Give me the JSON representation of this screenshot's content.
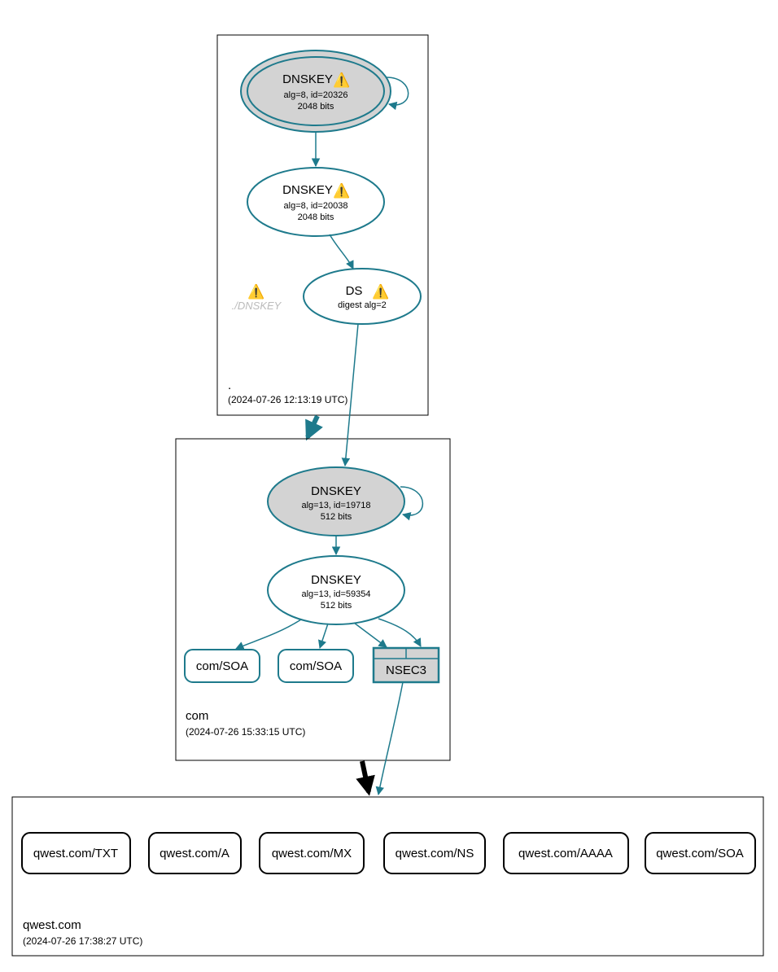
{
  "icons": {
    "warning": "⚠️"
  },
  "zones": {
    "root": {
      "name": ".",
      "timestamp": "(2024-07-26 12:13:19 UTC)"
    },
    "com": {
      "name": "com",
      "timestamp": "(2024-07-26 15:33:15 UTC)"
    },
    "qwest": {
      "name": "qwest.com",
      "timestamp": "(2024-07-26 17:38:27 UTC)"
    }
  },
  "nodes": {
    "root_ksk": {
      "title": "DNSKEY",
      "line1": "alg=8, id=20326",
      "line2": "2048 bits"
    },
    "root_zsk": {
      "title": "DNSKEY",
      "line1": "alg=8, id=20038",
      "line2": "2048 bits"
    },
    "root_ghost": {
      "label": "./DNSKEY"
    },
    "root_ds": {
      "title": "DS",
      "line1": "digest alg=2"
    },
    "com_ksk": {
      "title": "DNSKEY",
      "line1": "alg=13, id=19718",
      "line2": "512 bits"
    },
    "com_zsk": {
      "title": "DNSKEY",
      "line1": "alg=13, id=59354",
      "line2": "512 bits"
    },
    "com_soa1": {
      "title": "com/SOA"
    },
    "com_soa2": {
      "title": "com/SOA"
    },
    "com_nsec3": {
      "title": "NSEC3"
    },
    "q_txt": {
      "title": "qwest.com/TXT"
    },
    "q_a": {
      "title": "qwest.com/A"
    },
    "q_mx": {
      "title": "qwest.com/MX"
    },
    "q_ns": {
      "title": "qwest.com/NS"
    },
    "q_aaaa": {
      "title": "qwest.com/AAAA"
    },
    "q_soa": {
      "title": "qwest.com/SOA"
    }
  }
}
